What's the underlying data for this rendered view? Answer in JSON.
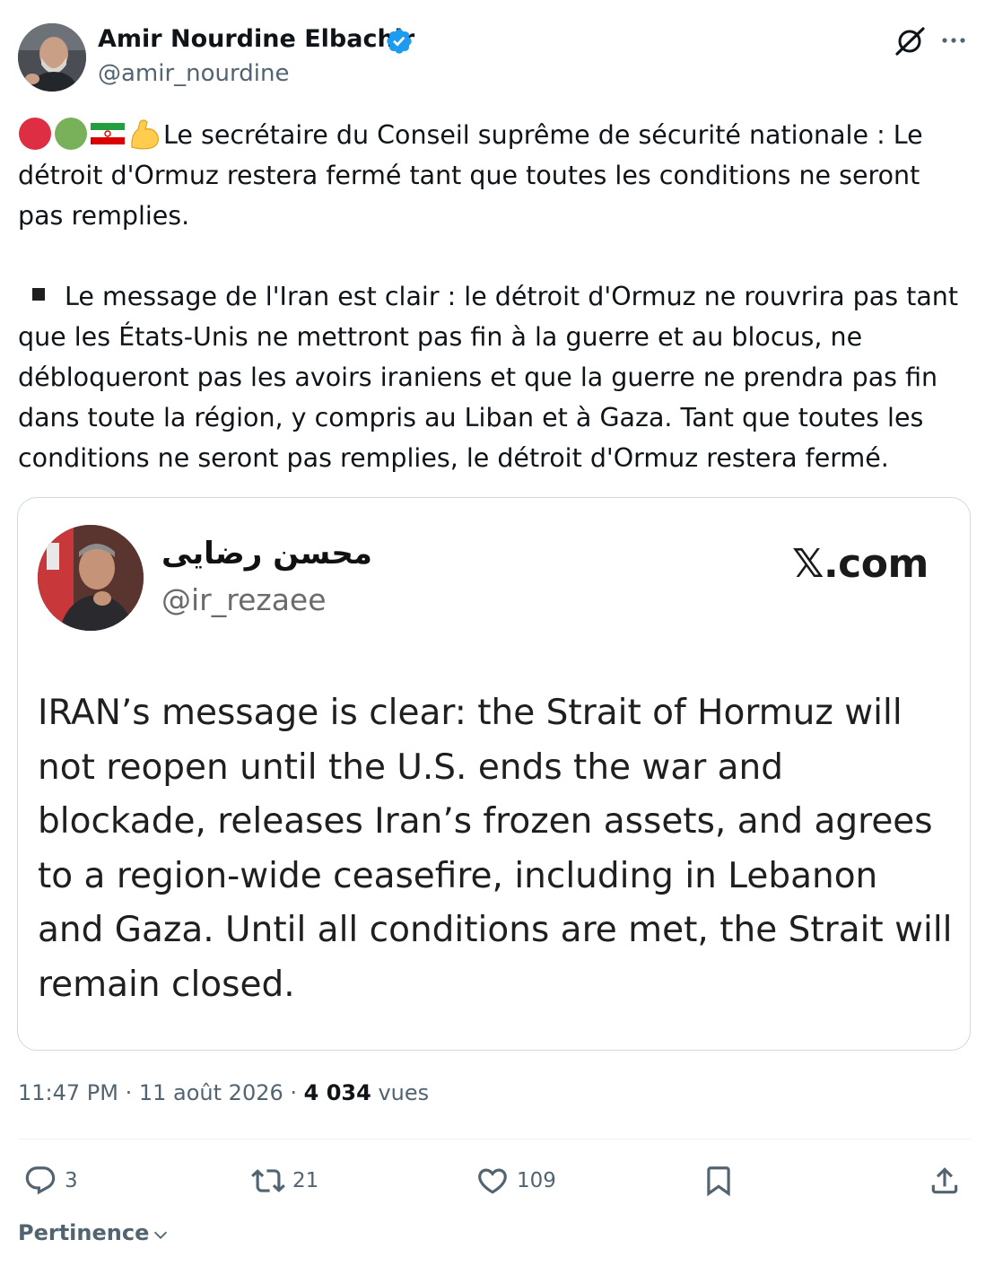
{
  "author": {
    "name": "Amir Nourdine Elbachir",
    "handle": "@amir_nourdine",
    "verified": true
  },
  "tweet": {
    "emoji": [
      "red-circle",
      "green-circle",
      "iran-flag",
      "flexed-biceps"
    ],
    "paragraph1": "Le secrétaire du Conseil suprême de sécurité nationale : Le détroit d'Ormuz restera fermé tant que toutes les conditions ne seront pas remplies.",
    "bullet_icon": "black-square",
    "paragraph2": "Le message de l'Iran est clair : le détroit d'Ormuz ne rouvrira pas tant que les États-Unis ne mettront pas fin à la guerre et au blocus, ne débloqueront pas les avoirs iraniens et que la guerre ne prendra pas fin dans toute la région, y compris au Liban et à Gaza. Tant que toutes les conditions ne seront pas remplies, le détroit d'Ormuz restera fermé."
  },
  "embedded": {
    "name": "محسن رضایی",
    "handle": "@ir_rezaee",
    "site": "𝕏.com",
    "text": "IRAN’s message is clear: the Strait of Hormuz will not reopen until the U.S. ends the war and blockade, releases Iran’s frozen assets, and agrees to a region-wide ceasefire, including in Lebanon and Gaza. Until all conditions are met, the Strait will remain closed."
  },
  "meta": {
    "time": "11:47 PM",
    "separator": " · ",
    "date": "11 août 2026",
    "views_count": "4 034",
    "views_label": "vues"
  },
  "actions": {
    "replies": "3",
    "reposts": "21",
    "likes": "109"
  },
  "sort": {
    "label": "Pertinence"
  },
  "colors": {
    "verified": "#1d9bf0",
    "secondary_text": "#536471",
    "primary_text": "#0f1419",
    "border": "#cfd9de"
  }
}
